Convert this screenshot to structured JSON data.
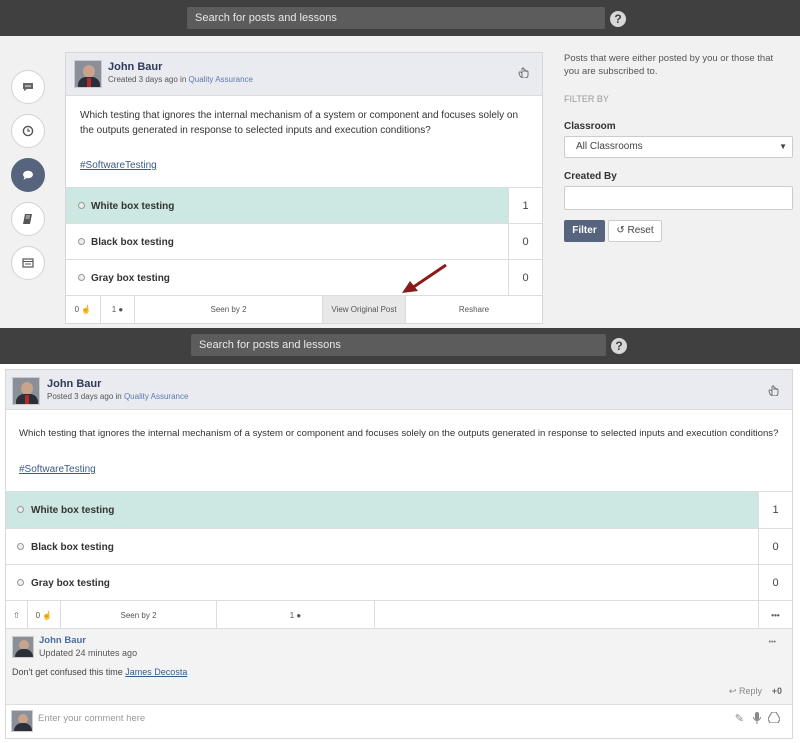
{
  "search": {
    "placeholder": "Search for posts and lessons"
  },
  "help_icon": "?",
  "sidebar": {
    "icons": [
      "comment-icon",
      "clock-icon",
      "chat-icon",
      "book-icon",
      "list-icon"
    ]
  },
  "post1": {
    "author": "John Baur",
    "meta_prefix": "Created 3 days ago in",
    "classroom": "Quality Assurance",
    "question": "Which testing that ignores the internal mechanism of a system or component and focuses solely on the outputs generated in response to selected inputs and execution conditions?",
    "tag": "#SoftwareTesting",
    "options": [
      {
        "label": "White box testing",
        "count": "1"
      },
      {
        "label": "Black box testing",
        "count": "0"
      },
      {
        "label": "Gray box testing",
        "count": "0"
      }
    ],
    "footer": {
      "likes": "0",
      "comments": "1",
      "seen": "Seen by 2",
      "view_original": "View Original Post",
      "reshare": "Reshare"
    }
  },
  "filter_panel": {
    "description": "Posts that were either posted by you or those that you are subscribed to.",
    "filter_by": "FILTER BY",
    "classroom_label": "Classroom",
    "classroom_value": "All Classrooms",
    "created_by_label": "Created By",
    "filter_button": "Filter",
    "reset_button": "Reset"
  },
  "post2": {
    "author": "John Baur",
    "meta_prefix": "Posted 3 days ago in",
    "classroom": "Quality Assurance",
    "question": "Which testing that ignores the internal mechanism of a system or component and focuses solely on the outputs generated in response to selected inputs and execution conditions?",
    "tag": "#SoftwareTesting",
    "options": [
      {
        "label": "White box testing",
        "count": "1"
      },
      {
        "label": "Black box testing",
        "count": "0"
      },
      {
        "label": "Gray box testing",
        "count": "0"
      }
    ],
    "footer": {
      "likes": "0",
      "seen": "Seen by 2",
      "comments": "1",
      "more": "•••"
    }
  },
  "comment": {
    "author": "John Baur",
    "updated": "Updated 24 minutes ago",
    "text_prefix": "Don't get confused this time",
    "mention": "James Decosta",
    "reply": "Reply",
    "plus": "+0",
    "more": "•••"
  },
  "comment_input": {
    "placeholder": "Enter your comment here"
  },
  "colors": {
    "topbar": "#404040",
    "accent": "#56657d",
    "highlight": "#cde8e3",
    "arrow": "#8b1a1a"
  }
}
